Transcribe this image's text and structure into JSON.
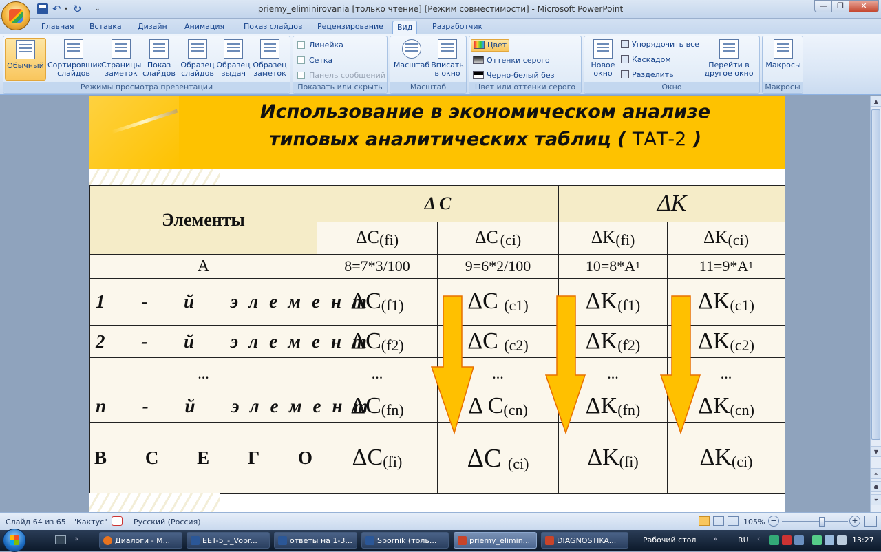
{
  "window": {
    "title": "priemy_eliminirovania [только чтение] [Режим совместимости] - Microsoft PowerPoint",
    "min_glyph": "—",
    "max_glyph": "❐",
    "close_glyph": "✕"
  },
  "qat": {
    "undo_glyph": "↶",
    "redo_glyph": "↻",
    "dropdown_glyph": "▾",
    "customize_glyph": "⌄"
  },
  "tabs": [
    "Главная",
    "Вставка",
    "Дизайн",
    "Анимация",
    "Показ слайдов",
    "Рецензирование",
    "Вид",
    "Разработчик"
  ],
  "active_tab": "Вид",
  "help_glyph": "?",
  "ribbon": {
    "views": {
      "label": "Режимы просмотра презентации",
      "buttons": [
        {
          "line1": "Обычный",
          "line2": ""
        },
        {
          "line1": "Сортировщик",
          "line2": "слайдов"
        },
        {
          "line1": "Страницы",
          "line2": "заметок"
        },
        {
          "line1": "Показ",
          "line2": "слайдов"
        },
        {
          "line1": "Образец",
          "line2": "слайдов"
        },
        {
          "line1": "Образец",
          "line2": "выдач"
        },
        {
          "line1": "Образец",
          "line2": "заметок"
        }
      ]
    },
    "show": {
      "label": "Показать или скрыть",
      "ruler": "Линейка",
      "grid": "Сетка",
      "message_bar": "Панель сообщений"
    },
    "zoom": {
      "label": "Масштаб",
      "zoom_btn": "Масштаб",
      "fit_line1": "Вписать",
      "fit_line2": "в окно"
    },
    "color": {
      "label": "Цвет или оттенки серого",
      "color": "Цвет",
      "grayscale": "Оттенки серого",
      "bw": "Черно-белый без серого"
    },
    "window": {
      "label": "Окно",
      "new_line1": "Новое",
      "new_line2": "окно",
      "arrange": "Упорядочить все",
      "cascade": "Каскадом",
      "split": "Разделить",
      "switch_line1": "Перейти в",
      "switch_line2": "другое окно"
    },
    "macros": {
      "label": "Макросы",
      "btn": "Макросы"
    }
  },
  "slide": {
    "title_line1": "Использование в экономическом анализе",
    "title_line2": "типовых аналитических таблиц (",
    "title_tat": "ТАТ-2",
    "title_close": ")",
    "table": {
      "col_elements": "Элементы",
      "group_c": "Δ C",
      "group_k": "ΔK",
      "sub": [
        {
          "main": "ΔC",
          "sub": "(fi)"
        },
        {
          "main": "ΔC",
          "sub": "(ci)"
        },
        {
          "main": "ΔK",
          "sub": "(fi)"
        },
        {
          "main": "ΔK",
          "sub": "(ci)"
        }
      ],
      "row_a": {
        "label": "А",
        "c1": "8=7*3/100",
        "c2": "9=6*2/100",
        "c3": "10=8*A",
        "c3_sup": "1",
        "c4": "11=9*A",
        "c4_sup": "1"
      },
      "rows": [
        {
          "label": "1 - й элемент",
          "cells": [
            [
              "ΔC",
              "(f1)"
            ],
            [
              "ΔC ",
              "(c1)"
            ],
            [
              "ΔK",
              "(f1)"
            ],
            [
              "ΔK",
              "(c1)"
            ]
          ]
        },
        {
          "label": "2 - й элемент",
          "cells": [
            [
              "ΔC",
              "(f2)"
            ],
            [
              "ΔC ",
              "(c2)"
            ],
            [
              "ΔK",
              "(f2)"
            ],
            [
              "ΔK",
              "(c2)"
            ]
          ]
        },
        {
          "label": "...",
          "cells": [
            [
              "...",
              ""
            ],
            [
              "...",
              ""
            ],
            [
              "...",
              ""
            ],
            [
              "...",
              ""
            ]
          ]
        },
        {
          "label": "n - й элемент",
          "cells": [
            [
              "ΔC",
              "(fn)"
            ],
            [
              "Δ C",
              "(cn)"
            ],
            [
              "ΔK",
              "(fn)"
            ],
            [
              "ΔK",
              "(cn)"
            ]
          ]
        }
      ],
      "total": {
        "label": "В С Е Г О",
        "cells": [
          [
            "ΔC",
            "(fi)"
          ],
          [
            "ΔC ",
            "(ci)"
          ],
          [
            "ΔK",
            "(fi)"
          ],
          [
            "ΔK",
            "(ci)"
          ]
        ]
      }
    }
  },
  "status": {
    "slide": "Слайд 64 из 65",
    "theme": "\"Кактус\"",
    "lang": "Русский (Россия)",
    "zoom": "105%",
    "zoom_level": 0.6
  },
  "taskbar": {
    "items": [
      "Диалоги - М...",
      "EET-5_-_Vopr...",
      "ответы на 1-3...",
      "Sbornik (толь...",
      "priemy_elimin...",
      "DIAGNOSTIKA..."
    ],
    "desktop": "Рабочий стол",
    "lang": "RU",
    "time": "13:27"
  },
  "colors": {
    "banner": "#fec200",
    "arrow_fill": "#ffc000",
    "arrow_stroke": "#e87000"
  }
}
